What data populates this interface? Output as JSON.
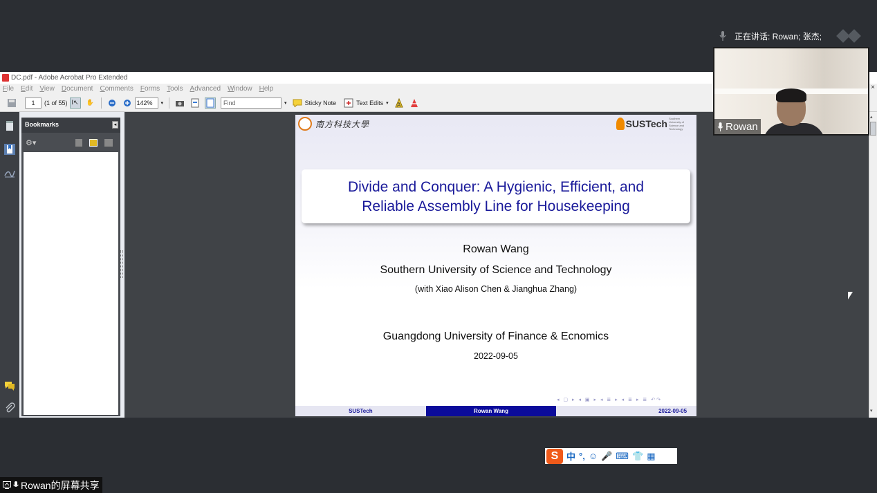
{
  "meeting": {
    "speaking_label": "正在讲话: Rowan; 张杰;",
    "video_name": "Rowan",
    "share_label": "Rowan的屏幕共享"
  },
  "acrobat": {
    "window_title": "DC.pdf - Adobe Acrobat Pro Extended",
    "menu": [
      "File",
      "Edit",
      "View",
      "Document",
      "Comments",
      "Forms",
      "Tools",
      "Advanced",
      "Window",
      "Help"
    ],
    "toolbar": {
      "page_value": "1",
      "page_of": "(1 of 55)",
      "zoom": "142%",
      "find_placeholder": "Find",
      "sticky_note": "Sticky Note",
      "text_edits": "Text Edits"
    },
    "bookmarks_title": "Bookmarks"
  },
  "slide": {
    "logo_cn": "南方科技大學",
    "logo_en": "SUSTech",
    "logo_en_small": "Southern University of Science and Technology",
    "title_line1": "Divide and Conquer: A Hygienic, Efficient, and",
    "title_line2": "Reliable Assembly Line for Housekeeping",
    "author": "Rowan Wang",
    "affiliation": "Southern University of Science and Technology",
    "coauthors": "(with Xiao Alison Chen & Jianghua Zhang)",
    "venue": "Guangdong University of Finance & Ecnomics",
    "date": "2022-09-05",
    "nav_symbols": "◂ ▢ ▸ ◂ ▣ ▸ ◂ ≣ ▸ ◂ ≣ ▸ ≣ ↶↷",
    "footer_left": "SUSTech",
    "footer_center": "Rowan Wang",
    "footer_right": "2022-09-05"
  },
  "ime": {
    "items": [
      "中",
      "°,",
      "☺",
      "🎤",
      "⌨",
      "👕",
      "▦"
    ]
  }
}
